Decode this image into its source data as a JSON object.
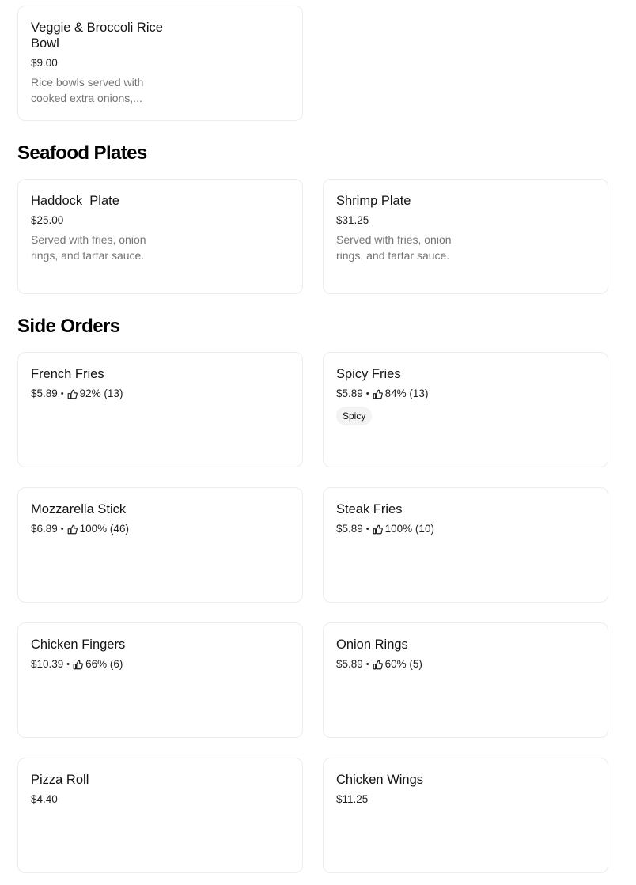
{
  "top_item": {
    "name": "Veggie & Broccoli Rice Bowl",
    "price": "$9.00",
    "description": "Rice bowls served with cooked extra onions,..."
  },
  "seafood": {
    "title": "Seafood Plates",
    "items": [
      {
        "name": "Haddock  Plate",
        "price": "$25.00",
        "description": "Served with fries, onion rings, and tartar sauce."
      },
      {
        "name": "Shrimp Plate",
        "price": "$31.25",
        "description": "Served with fries, onion rings, and tartar sauce."
      }
    ]
  },
  "sides": {
    "title": "Side Orders",
    "items": [
      {
        "name": "French Fries",
        "price": "$5.89",
        "sep": "•",
        "rating": "92% (13)"
      },
      {
        "name": "Spicy Fries",
        "price": "$5.89",
        "sep": "•",
        "rating": "84% (13)",
        "badge": "Spicy"
      },
      {
        "name": "Mozzarella Stick",
        "price": "$6.89",
        "sep": "•",
        "rating": "100% (46)"
      },
      {
        "name": "Steak Fries",
        "price": "$5.89",
        "sep": "•",
        "rating": "100% (10)"
      },
      {
        "name": "Chicken Fingers",
        "price": "$10.39",
        "sep": "•",
        "rating": "66% (6)"
      },
      {
        "name": "Onion Rings",
        "price": "$5.89",
        "sep": "•",
        "rating": "60% (5)"
      },
      {
        "name": "Pizza Roll",
        "price": "$4.40"
      },
      {
        "name": "Chicken Wings",
        "price": "$11.25"
      }
    ]
  },
  "icons": {
    "rating": "thumbs-up-icon"
  }
}
